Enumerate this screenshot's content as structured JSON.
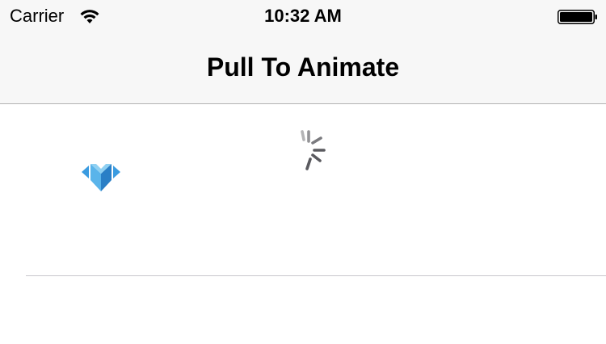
{
  "status_bar": {
    "carrier": "Carrier",
    "time": "10:32 AM"
  },
  "nav_bar": {
    "title": "Pull To Animate"
  },
  "icons": {
    "wifi": "wifi-icon",
    "battery": "battery-icon",
    "logo": "m-diamond-logo-icon",
    "spinner": "activity-spinner-icon"
  },
  "colors": {
    "bar_background": "#f7f7f7",
    "logo_blue": "#2f8fd8",
    "spinner": "#5a5a5f"
  }
}
